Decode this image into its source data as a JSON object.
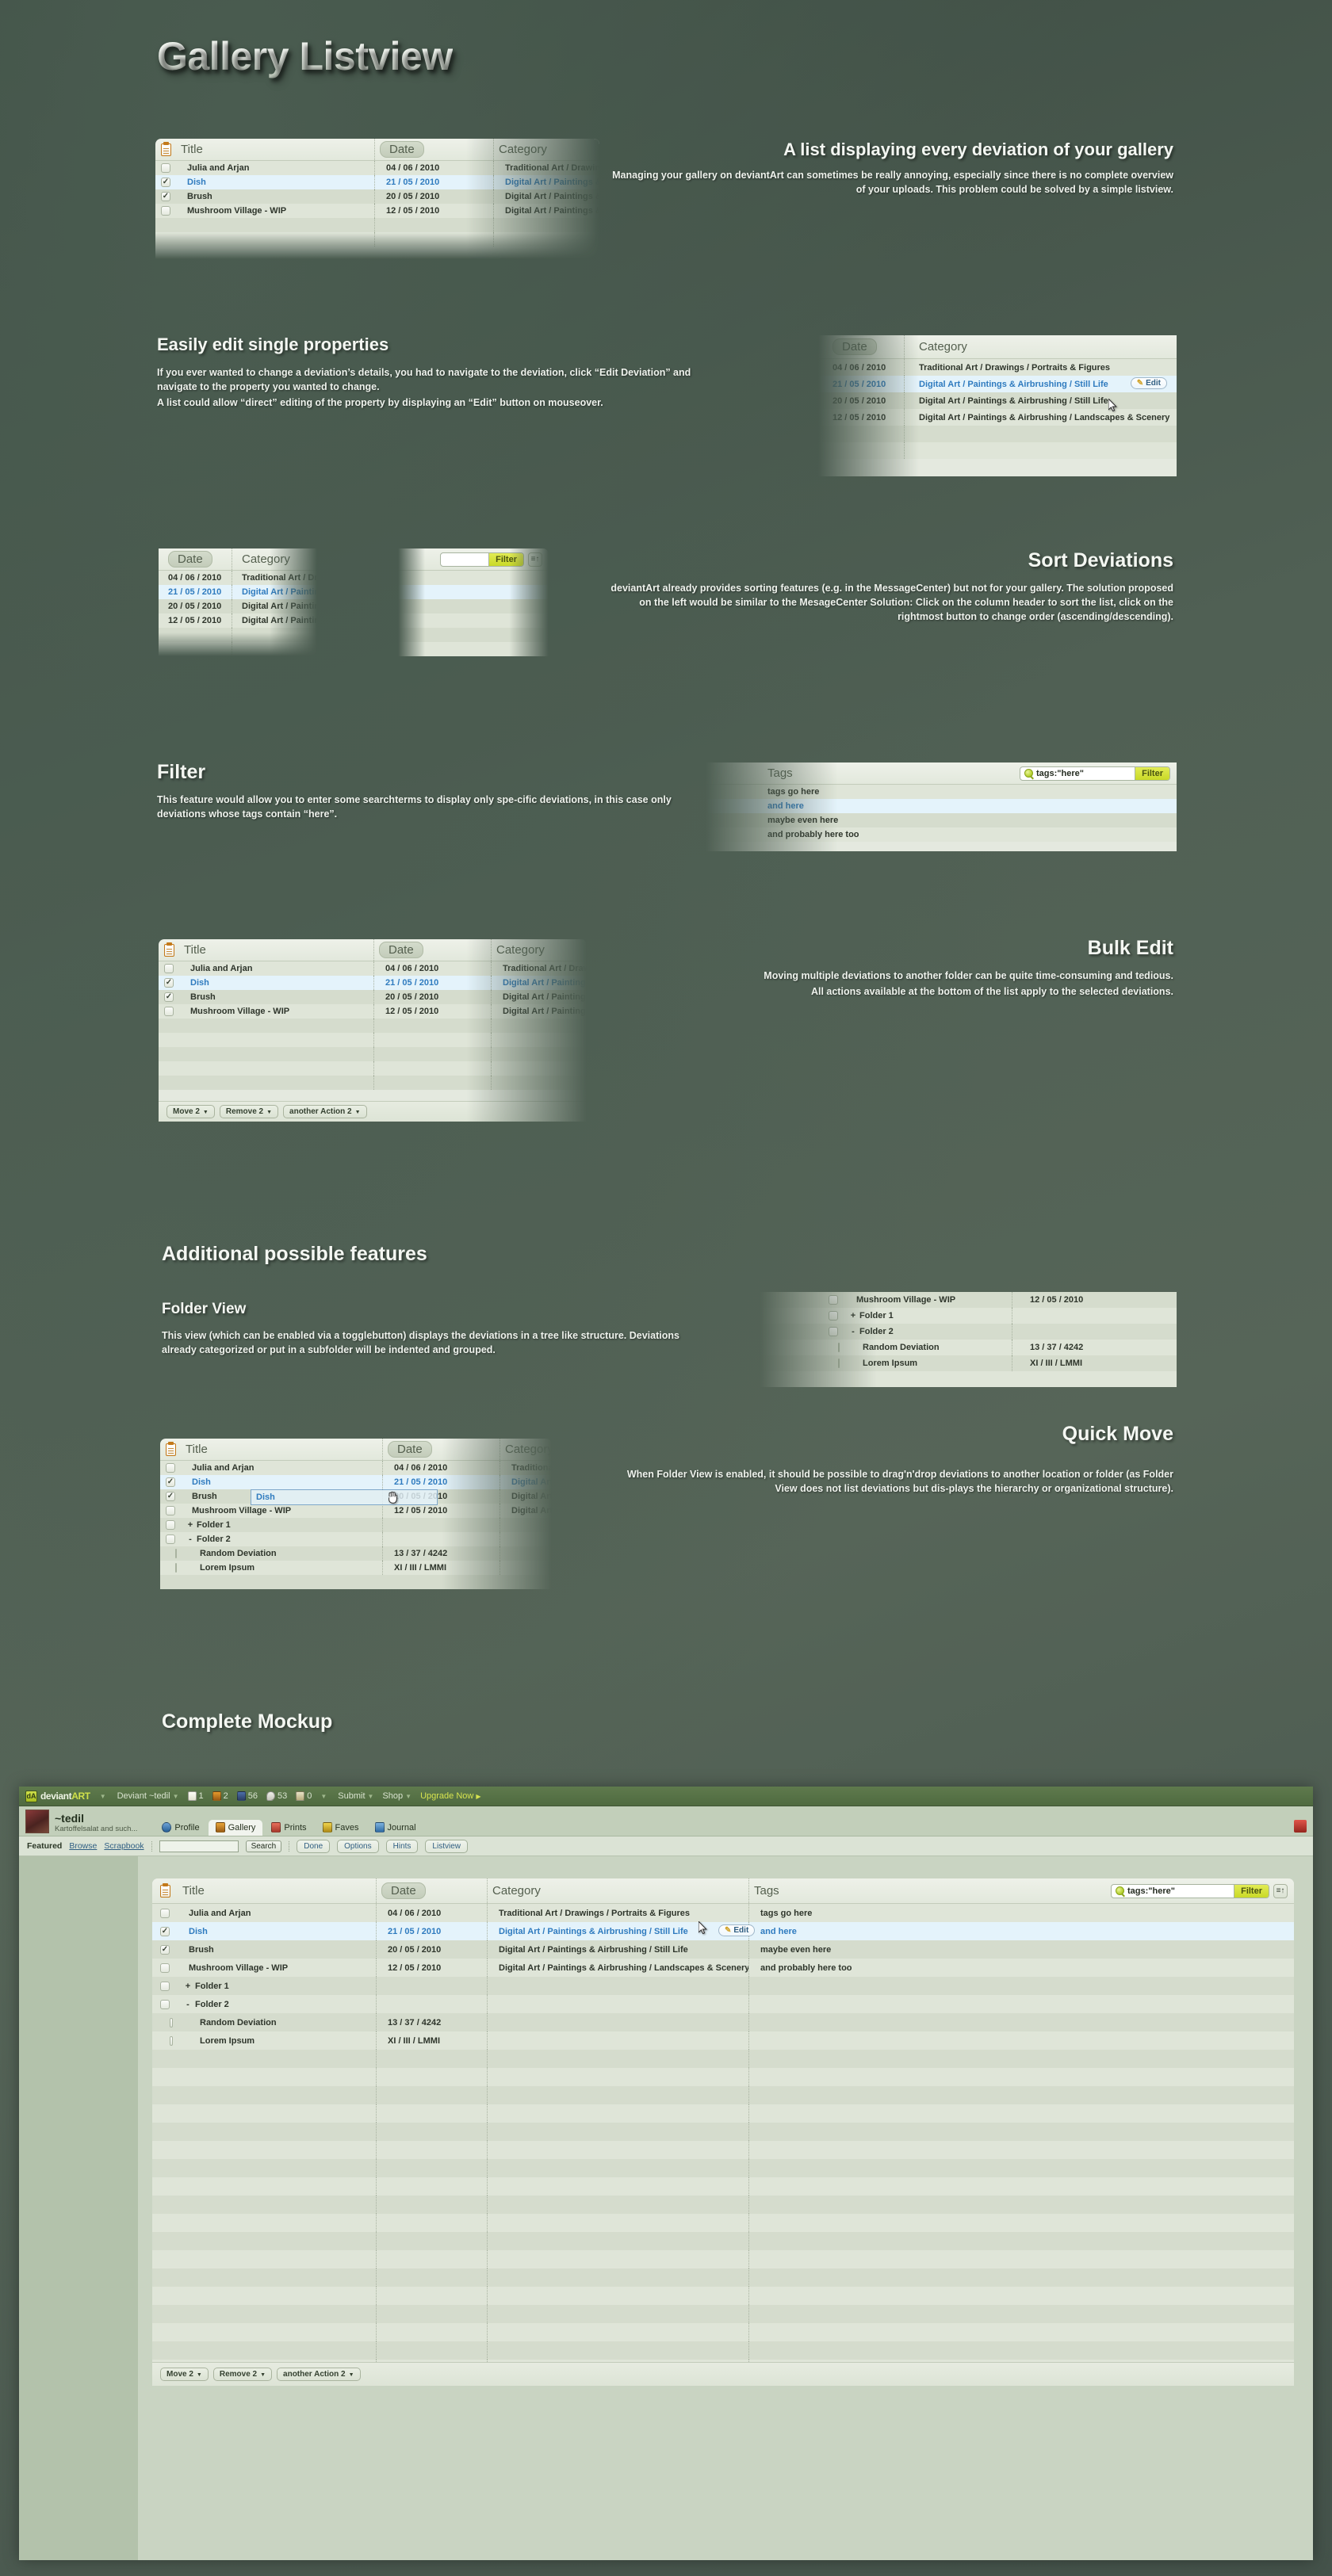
{
  "page": {
    "title": "Gallery Listview",
    "sections": {
      "intro": {
        "heading": "A list displaying every deviation of your gallery",
        "body": "Managing your gallery on deviantArt can sometimes be really annoying, especially since there is no complete overview of your uploads. This problem could be solved by a simple listview."
      },
      "edit": {
        "heading": "Easily edit single properties",
        "body_p1": "If you ever wanted to change a deviation’s details, you had to navigate to the deviation, click “Edit Deviation” and navigate to the property you wanted to change.",
        "body_p2": "A list could allow “direct” editing of the property by displaying an “Edit” button on mouseover."
      },
      "sort": {
        "heading": "Sort Deviations",
        "body": "deviantArt already provides sorting features (e.g. in the MessageCenter) but not for your gallery. The solution proposed on the left would be similar to the MesageCenter Solution: Click on the column header to sort the list, click on the rightmost button to change order (ascending/descending)."
      },
      "filter": {
        "heading": "Filter",
        "body": "This feature would allow you to enter some searchterms to display only spe-cific deviations, in this case only deviations whose tags contain “here”."
      },
      "bulk": {
        "heading": "Bulk Edit",
        "body_p1": "Moving multiple deviations to another folder can be quite time-consuming and tedious.",
        "body_p2": "All actions available at the bottom of the list apply to the selected deviations."
      },
      "additional": {
        "heading": "Additional possible features"
      },
      "folder": {
        "heading": "Folder View",
        "body": "This view (which can be enabled via a togglebutton) displays the deviations in a tree like structure. Deviations already categorized or put in a subfolder will be indented and grouped."
      },
      "quickmove": {
        "heading": "Quick Move",
        "body": "When Folder View is enabled, it should be possible to drag'n'drop deviations to another location or folder (as Folder View does not list deviations but dis-plays the hierarchy or organizational structure)."
      },
      "complete": {
        "heading": "Complete Mockup"
      }
    }
  },
  "listview": {
    "columns": {
      "title": "Title",
      "date": "Date",
      "category": "Category",
      "tags": "Tags"
    },
    "icons": {
      "clipboard": "clipboard-icon",
      "sort": "sort-order-icon",
      "pencil": "pencil-icon",
      "magnifier": "magnifier-icon"
    },
    "rows": [
      {
        "checked": false,
        "title": "Julia and Arjan",
        "date": "04 / 06 / 2010",
        "category": "Traditional Art / Drawings / Portraits & Figures",
        "tag": "tags go here",
        "selected": false
      },
      {
        "checked": true,
        "title": "Dish",
        "date": "21 / 05 / 2010",
        "category": "Digital Art / Paintings & Airbrushing / Still Life",
        "tag": "and here",
        "selected": true
      },
      {
        "checked": true,
        "title": "Brush",
        "date": "20 / 05 / 2010",
        "category": "Digital Art / Paintings & Airbrushing / Still Life",
        "tag": "maybe even here",
        "selected": false
      },
      {
        "checked": false,
        "title": "Mushroom Village - WIP",
        "date": "12 / 05 / 2010",
        "category": "Digital Art / Paintings & Airbrushing / Landscapes & Scenery",
        "tag": "and probably here too",
        "selected": false
      }
    ],
    "folder_rows": [
      {
        "checked": false,
        "toggle": "+",
        "title": "Folder 1",
        "date": "",
        "indent": 0
      },
      {
        "checked": false,
        "toggle": "-",
        "title": "Folder 2",
        "date": "",
        "indent": 0
      },
      {
        "checked": false,
        "toggle": "",
        "title": "Random Deviation",
        "date": "13 / 37 / 4242",
        "indent": 1
      },
      {
        "checked": false,
        "toggle": "",
        "title": "Lorem Ipsum",
        "date": "XI / III / LMMI",
        "indent": 1
      }
    ],
    "filter": {
      "value": "tags:\"here\"",
      "button": "Filter"
    },
    "edit_button": "Edit",
    "actions": [
      "Move 2",
      "Remove 2",
      "another Action 2"
    ],
    "drag_label": "Dish"
  },
  "mockup": {
    "topbar": {
      "brand": "deviantART",
      "brand_light": "deviant",
      "brand_bold": "ART",
      "deviant_label": "Deviant ~tedil",
      "counters": [
        {
          "icon": "note-icon",
          "value": "1"
        },
        {
          "icon": "deviation-icon",
          "value": "2"
        },
        {
          "icon": "watch-icon",
          "value": "56"
        },
        {
          "icon": "comment-icon",
          "value": "53"
        },
        {
          "icon": "critique-icon",
          "value": "0"
        }
      ],
      "submit": "Submit",
      "shop": "Shop",
      "upgrade": "Upgrade Now"
    },
    "user": {
      "name": "~tedil",
      "tagline": "Kartoffelsalat and such...",
      "tabs": [
        {
          "label": "Profile",
          "icon": "info-icon",
          "active": false
        },
        {
          "label": "Gallery",
          "icon": "gallery-icon",
          "active": true
        },
        {
          "label": "Prints",
          "icon": "prints-icon",
          "active": false
        },
        {
          "label": "Faves",
          "icon": "faves-icon",
          "active": false
        },
        {
          "label": "Journal",
          "icon": "journal-icon",
          "active": false
        }
      ]
    },
    "subbar": {
      "featured": "Featured",
      "browse": "Browse",
      "scrapbook": "Scrapbook",
      "search_value": "",
      "search_button": "Search",
      "buttons": [
        "Done",
        "Options",
        "Hints",
        "Listview"
      ]
    }
  }
}
